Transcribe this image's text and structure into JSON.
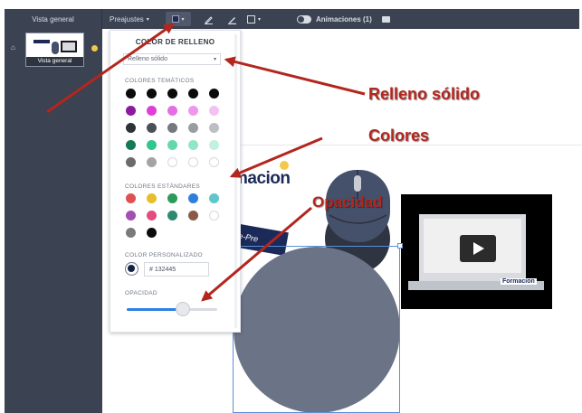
{
  "toolbar": {
    "overview_tab": "Vista general",
    "presets_label": "Preajustes",
    "presets_caret": "▾",
    "fill_swatch_color": "#132445",
    "animations_label": "Animaciones (1)",
    "icons": [
      "fill-color-icon",
      "pen-icon",
      "stroke-pen-icon",
      "border-icon",
      "toggle-icon",
      "chat-icon"
    ]
  },
  "sidebar": {
    "home_icon": "⌂",
    "thumbnail_label": "Vista general"
  },
  "fill_panel": {
    "title": "COLOR DE RELLENO",
    "fill_type": "Relleno sólido",
    "theme_colors_title": "COLORES TEMÁTICOS",
    "theme_colors": [
      [
        "#0b0b0b",
        "#0b0b0b",
        "#0b0b0b",
        "#0b0b0b",
        "#0b0b0b"
      ],
      [
        "#8b1aa0",
        "#e23cd8",
        "#e46fe3",
        "#ee98ec",
        "#f3c2f1"
      ],
      [
        "#2f3338",
        "#4b5057",
        "#75797f",
        "#999ca1",
        "#bcbec2"
      ],
      [
        "#137a53",
        "#32c58f",
        "#64d8ad",
        "#93e5c6",
        "#c3f0df"
      ],
      [
        "#6b6b6b",
        "#a4a4a4",
        "",
        "",
        ""
      ]
    ],
    "standard_colors_title": "COLORES ESTÁNDARES",
    "standard_colors": [
      [
        "#e05050",
        "#e7bd2a",
        "#2d9a5b",
        "#2e7fdc",
        "#5fc6cc"
      ],
      [
        "#a34fb2",
        "#e24d7d",
        "#2d8a6e",
        "#8a5a48",
        ""
      ],
      [
        "#7a7a7a",
        "#0b0b0b"
      ]
    ],
    "custom_color_title": "COLOR PERSONALIZADO",
    "custom_color_value": "# 132445",
    "custom_color": "#132445",
    "opacity_title": "OPACIDAD",
    "opacity_fraction": 0.62
  },
  "canvas": {
    "brand_text": "macion",
    "banner_text": "e-Pre",
    "video_brand": "Formacion",
    "circle_color": "#6b7387"
  },
  "annotations": {
    "relleno": "Relleno sólido",
    "colores": "Colores",
    "opacidad": "Opacidad",
    "arrow_color": "#b3261e"
  }
}
